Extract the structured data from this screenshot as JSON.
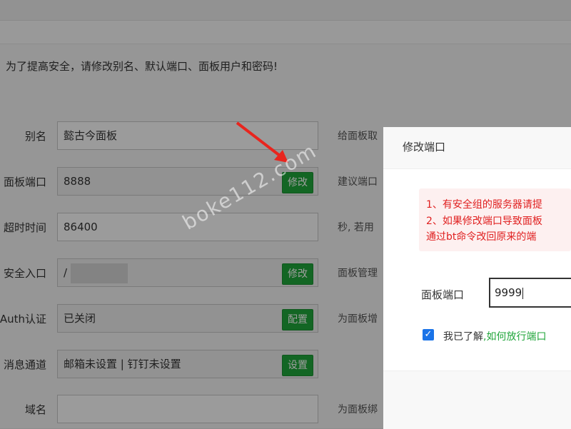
{
  "notice": "为了提高安全，请修改别名、默认端口、面板用户和密码!",
  "rows": [
    {
      "label": "别名",
      "value": "懿古今面板",
      "button": "",
      "hint": "给面板取"
    },
    {
      "label": "面板端口",
      "value": "8888",
      "button": "修改",
      "hint": "建议端口"
    },
    {
      "label": "超时时间",
      "value": "86400",
      "button": "",
      "hint": "秒, 若用"
    },
    {
      "label": "安全入口",
      "value": "/",
      "button": "修改",
      "hint": "面板管理"
    },
    {
      "label": "Auth认证",
      "value": "已关闭",
      "button": "配置",
      "hint": "为面板增"
    },
    {
      "label": "消息通道",
      "value": "邮箱未设置 | 钉钉未设置",
      "button": "设置",
      "hint": ""
    },
    {
      "label": "域名",
      "value": "",
      "button": "",
      "hint": "为面板绑"
    }
  ],
  "modal": {
    "title": "修改端口",
    "alert_lines": [
      "1、有安全组的服务器请提",
      "2、如果修改端口导致面板",
      "通过bt命令改回原来的端"
    ],
    "port_label": "面板端口",
    "port_value": "9999",
    "checkbox_label": "我已了解",
    "checkbox_link": ",如何放行端口",
    "checkbox_checked": true
  },
  "watermark": "boke112.com",
  "colors": {
    "accent": "#20a53a",
    "alert_text": "#e02020",
    "checkbox": "#1a73e8"
  }
}
